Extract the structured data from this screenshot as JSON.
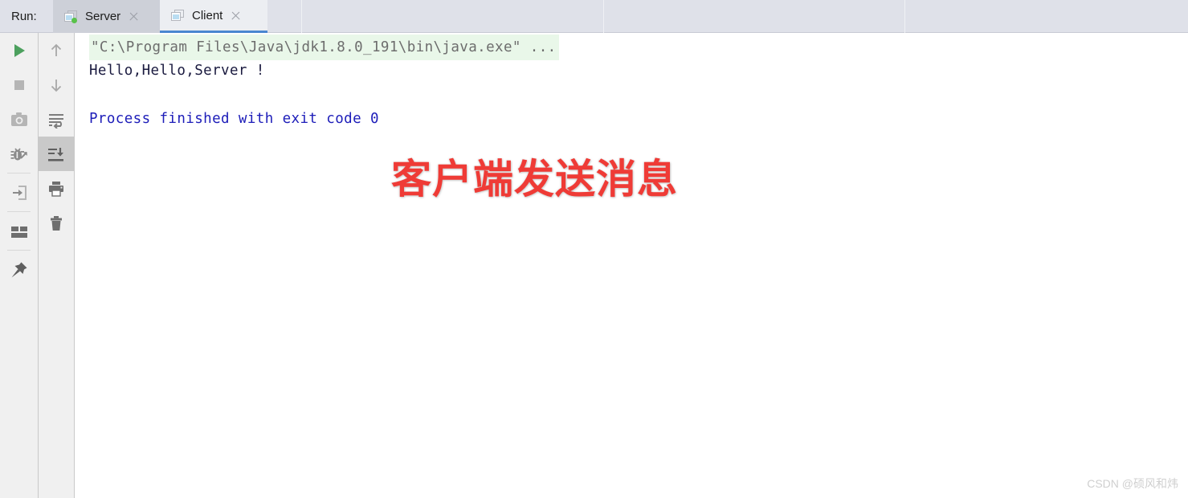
{
  "header": {
    "run_label": "Run:",
    "tabs": [
      {
        "label": "Server",
        "icon": "window-icon",
        "running": true,
        "selected": false,
        "close_icon": "close-icon"
      },
      {
        "label": "Client",
        "icon": "window-icon",
        "running": false,
        "selected": true,
        "close_icon": "close-icon"
      }
    ]
  },
  "toolbar_primary": {
    "buttons": [
      {
        "name": "rerun-button",
        "icon": "play-icon"
      },
      {
        "name": "stop-button",
        "icon": "stop-icon"
      },
      {
        "name": "screenshot-button",
        "icon": "camera-icon"
      },
      {
        "name": "debug-button",
        "icon": "bug-icon"
      },
      {
        "name": "restore-layout-button",
        "icon": "arrow-into-box-icon"
      },
      {
        "name": "layout-button",
        "icon": "layout-grid-icon"
      },
      {
        "name": "pin-tab-button",
        "icon": "pin-icon"
      }
    ]
  },
  "toolbar_secondary": {
    "buttons": [
      {
        "name": "up-button",
        "icon": "arrow-up-icon"
      },
      {
        "name": "down-button",
        "icon": "arrow-down-icon"
      },
      {
        "name": "soft-wrap-button",
        "icon": "soft-wrap-icon"
      },
      {
        "name": "scroll-to-end-button",
        "icon": "scroll-to-end-icon",
        "pressed": true
      },
      {
        "name": "print-button",
        "icon": "printer-icon"
      },
      {
        "name": "clear-all-button",
        "icon": "trash-icon"
      }
    ]
  },
  "console": {
    "command_line": "\"C:\\Program Files\\Java\\jdk1.8.0_191\\bin\\java.exe\" ...",
    "output_line": "Hello,Hello,Server !",
    "exit_line": "Process finished with exit code 0",
    "colors": {
      "command_text": "#6d6d6d",
      "command_highlight": "#e9f7e9",
      "output_text": "#1a1a3f",
      "exit_text": "#1d1db9"
    }
  },
  "annotation": {
    "text": "客户端发送消息",
    "color": "#ef3b36"
  },
  "watermark": {
    "text": "CSDN @硕风和炜"
  }
}
